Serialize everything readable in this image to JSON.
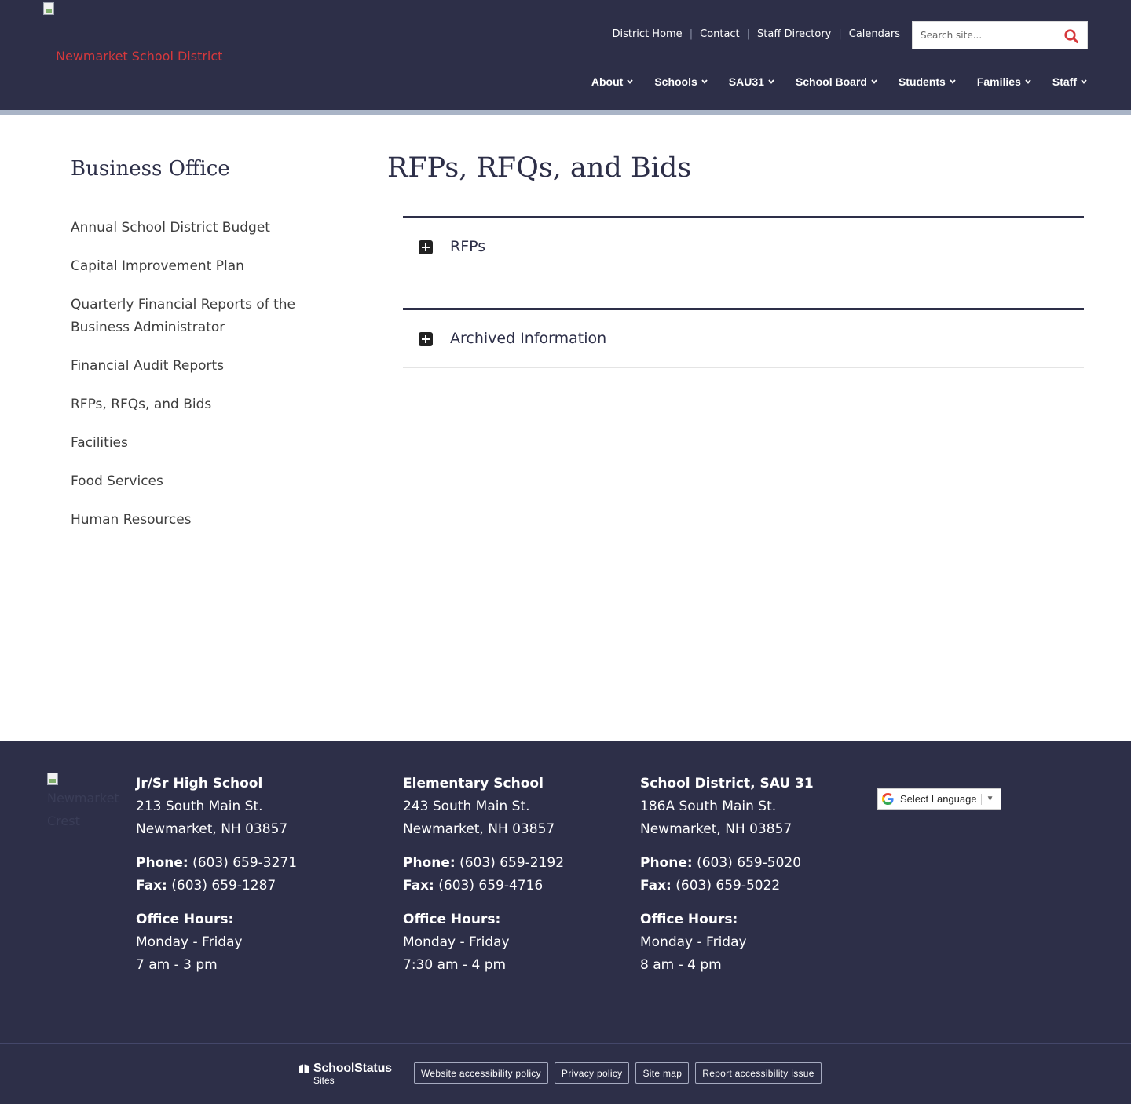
{
  "header": {
    "site_name": "Newmarket School District",
    "utility_links": [
      "District Home",
      "Contact",
      "Staff Directory",
      "Calendars"
    ],
    "search": {
      "placeholder": "Search site..."
    },
    "nav": [
      "About",
      "Schools",
      "SAU31",
      "School Board",
      "Students",
      "Families",
      "Staff"
    ]
  },
  "sidebar": {
    "title": "Business Office",
    "items": [
      "Annual School District Budget",
      "Capital Improvement Plan",
      "Quarterly Financial Reports of the Business Administrator",
      "Financial Audit Reports",
      "RFPs, RFQs, and Bids",
      "Facilities",
      "Food Services",
      "Human Resources"
    ]
  },
  "main": {
    "title": "RFPs, RFQs, and Bids",
    "accordions": [
      "RFPs",
      "Archived Information"
    ]
  },
  "footer": {
    "logo_alt": "Newmarket Crest",
    "columns": [
      {
        "title": "Jr/Sr High School",
        "address1": "213 South Main St.",
        "address2": "Newmarket, NH 03857",
        "phone_label": "Phone:",
        "phone": "(603) 659-3271",
        "fax_label": "Fax:",
        "fax": "(603) 659-1287",
        "hours_label": "Office Hours:",
        "days": "Monday - Friday",
        "hours": "7 am - 3 pm"
      },
      {
        "title": "Elementary School",
        "address1": "243 South Main St.",
        "address2": "Newmarket, NH 03857",
        "phone_label": "Phone:",
        "phone": "(603) 659-2192",
        "fax_label": "Fax:",
        "fax": "(603) 659-4716",
        "hours_label": "Office Hours:",
        "days": "Monday - Friday",
        "hours": "7:30 am - 4 pm"
      },
      {
        "title": "School District, SAU 31",
        "address1": "186A South Main St.",
        "address2": "Newmarket, NH 03857",
        "phone_label": "Phone:",
        "phone": "(603) 659-5020",
        "fax_label": "Fax:",
        "fax": "(603) 659-5022",
        "hours_label": "Office Hours:",
        "days": "Monday - Friday",
        "hours": "8 am - 4 pm"
      }
    ],
    "language": "Select Language",
    "brand_name": "SchoolStatus",
    "brand_sub": "Sites",
    "links": [
      "Website accessibility policy",
      "Privacy policy",
      "Site map",
      "Report accessibility issue"
    ]
  },
  "colors": {
    "header_bg": "#2d2f48",
    "accent_red": "#d6383c",
    "strip": "#a9b4c6",
    "text_dark": "#2d2f48"
  }
}
